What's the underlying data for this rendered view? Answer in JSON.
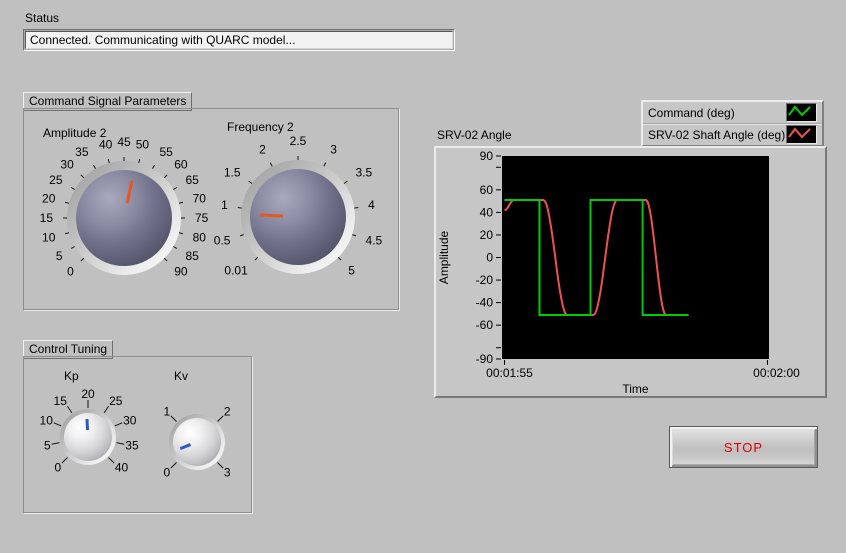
{
  "status": {
    "label": "Status",
    "value": "Connected. Communicating with QUARC model..."
  },
  "groups": {
    "command": {
      "title": "Command Signal Parameters",
      "knobs": [
        {
          "label": "Amplitude 2",
          "min": 0,
          "max": 90,
          "value": 49,
          "size": "large",
          "minor_ticks": 4,
          "needle_color": "#e8571f",
          "tick_labels": [
            "0",
            "5",
            "10",
            "15",
            "20",
            "25",
            "30",
            "35",
            "40",
            "45",
            "50",
            "55",
            "60",
            "65",
            "70",
            "75",
            "80",
            "85",
            "90"
          ]
        },
        {
          "label": "Frequency 2",
          "min": 0.01,
          "max": 5,
          "value": 0.9,
          "size": "large",
          "minor_ticks": 4,
          "needle_color": "#e8571f",
          "tick_labels": [
            "0.01",
            "0.5",
            "1",
            "1.5",
            "2",
            "2.5",
            "3",
            "3.5",
            "4",
            "4.5",
            "5"
          ]
        }
      ]
    },
    "tuning": {
      "title": "Control Tuning",
      "knobs": [
        {
          "label": "Kp",
          "min": 0,
          "max": 40,
          "value": 19.5,
          "size": "small",
          "minor_ticks": 0,
          "needle_color": "#3353cb",
          "tick_labels": [
            "0",
            "5",
            "10",
            "15",
            "20",
            "25",
            "30",
            "35",
            "40"
          ]
        },
        {
          "label": "Kv",
          "min": 0,
          "max": 3,
          "value": 0.26,
          "size": "small",
          "minor_ticks": 0,
          "needle_color": "#3353cb",
          "tick_labels": [
            "0",
            "1",
            "2",
            "3"
          ]
        }
      ]
    }
  },
  "chart_data": {
    "type": "line",
    "title": "SRV-02 Angle",
    "xlabel": "Time",
    "ylabel": "Amplitude",
    "x_range_seconds": [
      0,
      5
    ],
    "x_tick_labels": [
      "00:01:55",
      "00:02:00"
    ],
    "ylim": [
      -90,
      90
    ],
    "y_tick_labels": [
      90,
      60,
      40,
      20,
      0,
      -20,
      -40,
      -60,
      -90
    ],
    "y_minor_ticks": [
      80,
      -80
    ],
    "plot_background": "#000000",
    "legend": [
      {
        "label": "Command (deg)",
        "color": "#00cc00"
      },
      {
        "label": "SRV-02 Shaft Angle (deg)",
        "color": "#ed5151"
      }
    ],
    "series": [
      {
        "name": "Command (deg)",
        "color": "#00cc00",
        "interp": "linear",
        "points": [
          [
            0,
            51
          ],
          [
            0.665,
            51
          ],
          [
            0.665,
            -51
          ],
          [
            1.635,
            -51
          ],
          [
            1.635,
            51
          ],
          [
            2.625,
            51
          ],
          [
            2.625,
            -51
          ],
          [
            3.5,
            -51
          ]
        ]
      },
      {
        "name": "SRV-02 Shaft Angle (deg)",
        "color": "#ed5151",
        "interp": "smooth",
        "points": [
          [
            0,
            42
          ],
          [
            0.18,
            51
          ],
          [
            0.74,
            51
          ],
          [
            1.19,
            -51
          ],
          [
            1.69,
            -51
          ],
          [
            2.14,
            51
          ],
          [
            2.69,
            51
          ],
          [
            3.07,
            -51
          ],
          [
            3.5,
            -51
          ]
        ]
      }
    ]
  },
  "stop_button": {
    "label": "STOP",
    "text_color": "#e00000"
  }
}
